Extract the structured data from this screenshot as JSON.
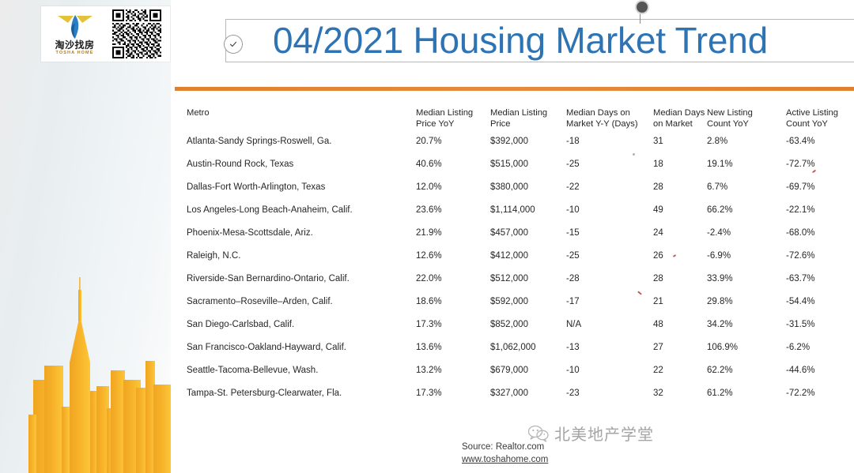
{
  "slide": {
    "title": "04/2021 Housing Market Trend",
    "accent_blue": "#2E74B5",
    "accent_orange": "#E0812F",
    "skyline_color": "#F5A623"
  },
  "brand": {
    "logo_cn": "淘沙找房",
    "logo_en": "TOSHA HOME",
    "qr_label": "qr-code"
  },
  "table": {
    "headers": [
      "Metro",
      "Median Listing Price YoY",
      "Median Listing Price",
      "Median Days on Market Y-Y (Days)",
      "Median Days on Market",
      "New Listing Count YoY",
      "Active Listing Count YoY"
    ],
    "headers_l1": [
      "Metro",
      "Median Listing",
      "Median Listing",
      "Median Days on",
      "Median Days",
      "New Listing",
      "Active Listing"
    ],
    "headers_l2": [
      "",
      "Price YoY",
      "Price",
      "Market Y-Y (Days)",
      "on Market",
      "Count YoY",
      "Count YoY"
    ],
    "rows": [
      {
        "metro": "Atlanta-Sandy Springs-Roswell, Ga.",
        "price_yoy": "20.7%",
        "price": "$392,000",
        "dom_yy": "-18",
        "dom": "31",
        "new_listing_yoy": "2.8%",
        "active_listing_yoy": "-63.4%"
      },
      {
        "metro": "Austin-Round Rock, Texas",
        "price_yoy": "40.6%",
        "price": "$515,000",
        "dom_yy": "-25",
        "dom": "18",
        "new_listing_yoy": "19.1%",
        "active_listing_yoy": "-72.7%"
      },
      {
        "metro": "Dallas-Fort Worth-Arlington, Texas",
        "price_yoy": "12.0%",
        "price": "$380,000",
        "dom_yy": "-22",
        "dom": "28",
        "new_listing_yoy": "6.7%",
        "active_listing_yoy": "-69.7%"
      },
      {
        "metro": "Los Angeles-Long Beach-Anaheim, Calif.",
        "price_yoy": "23.6%",
        "price": "$1,114,000",
        "dom_yy": "-10",
        "dom": "49",
        "new_listing_yoy": "66.2%",
        "active_listing_yoy": "-22.1%"
      },
      {
        "metro": "Phoenix-Mesa-Scottsdale, Ariz.",
        "price_yoy": "21.9%",
        "price": "$457,000",
        "dom_yy": "-15",
        "dom": "24",
        "new_listing_yoy": "-2.4%",
        "active_listing_yoy": "-68.0%"
      },
      {
        "metro": "Raleigh, N.C.",
        "price_yoy": "12.6%",
        "price": "$412,000",
        "dom_yy": "-25",
        "dom": "26",
        "new_listing_yoy": "-6.9%",
        "active_listing_yoy": "-72.6%"
      },
      {
        "metro": "Riverside-San Bernardino-Ontario, Calif.",
        "price_yoy": "22.0%",
        "price": "$512,000",
        "dom_yy": "-28",
        "dom": "28",
        "new_listing_yoy": "33.9%",
        "active_listing_yoy": "-63.7%"
      },
      {
        "metro": "Sacramento–Roseville–Arden, Calif.",
        "price_yoy": "18.6%",
        "price": "$592,000",
        "dom_yy": "-17",
        "dom": "21",
        "new_listing_yoy": "29.8%",
        "active_listing_yoy": "-54.4%"
      },
      {
        "metro": "San Diego-Carlsbad, Calif.",
        "price_yoy": "17.3%",
        "price": "$852,000",
        "dom_yy": "N/A",
        "dom": "48",
        "new_listing_yoy": "34.2%",
        "active_listing_yoy": "-31.5%"
      },
      {
        "metro": "San Francisco-Oakland-Hayward, Calif.",
        "price_yoy": "13.6%",
        "price": "$1,062,000",
        "dom_yy": "-13",
        "dom": "27",
        "new_listing_yoy": "106.9%",
        "active_listing_yoy": "-6.2%"
      },
      {
        "metro": "Seattle-Tacoma-Bellevue, Wash.",
        "price_yoy": "13.2%",
        "price": "$679,000",
        "dom_yy": "-10",
        "dom": "22",
        "new_listing_yoy": "62.2%",
        "active_listing_yoy": "-44.6%"
      },
      {
        "metro": "Tampa-St. Petersburg-Clearwater, Fla.",
        "price_yoy": "17.3%",
        "price": "$327,000",
        "dom_yy": "-23",
        "dom": "32",
        "new_listing_yoy": "61.2%",
        "active_listing_yoy": "-72.2%"
      }
    ]
  },
  "footer": {
    "source": "Source: Realtor.com",
    "url": "www.toshahome.com"
  },
  "watermark": {
    "text": "北美地产学堂",
    "icon": "wechat-icon"
  }
}
